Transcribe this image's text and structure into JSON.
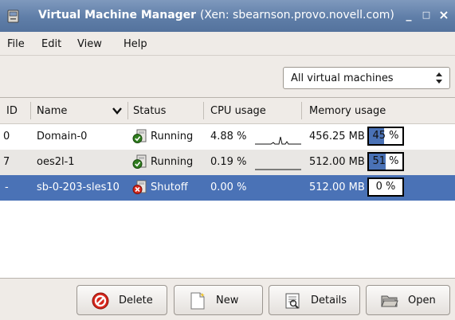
{
  "window": {
    "title": "Virtual Machine Manager",
    "title_detail": "(Xen: sbearnson.provo.novell.com)",
    "controls": {
      "minimize": "_",
      "maximize": "□",
      "close": "×"
    }
  },
  "menu": {
    "file": "File",
    "edit": "Edit",
    "view": "View",
    "help": "Help"
  },
  "filter": {
    "selected": "All virtual machines",
    "arrows": "▲▼"
  },
  "table": {
    "columns": {
      "id": "ID",
      "name": "Name",
      "status": "Status",
      "cpu": "CPU usage",
      "memory": "Memory usage"
    },
    "sort_indicator": "❯",
    "rows": [
      {
        "id": "0",
        "name": "Domain-0",
        "status": "Running",
        "status_icon": "running-icon",
        "cpu": "4.88 %",
        "memory": "456.25 MB",
        "mem_percent": "45 %",
        "mem_fraction": 0.45
      },
      {
        "id": "7",
        "name": "oes2l-1",
        "status": "Running",
        "status_icon": "running-icon",
        "cpu": "0.19 %",
        "memory": "512.00 MB",
        "mem_percent": "51 %",
        "mem_fraction": 0.51
      },
      {
        "id": "-",
        "name": "sb-0-203-sles10",
        "status": "Shutoff",
        "status_icon": "shutoff-icon",
        "cpu": "0.00 %",
        "memory": "512.00 MB",
        "mem_percent": "0 %",
        "mem_fraction": 0.0,
        "selected": true
      }
    ]
  },
  "buttons": {
    "delete": "Delete",
    "new": "New",
    "details": "Details",
    "open": "Open"
  },
  "colors": {
    "titlebar": "#5f7ea8",
    "selection": "#4a72b6",
    "delete_icon": "#d6261b"
  }
}
